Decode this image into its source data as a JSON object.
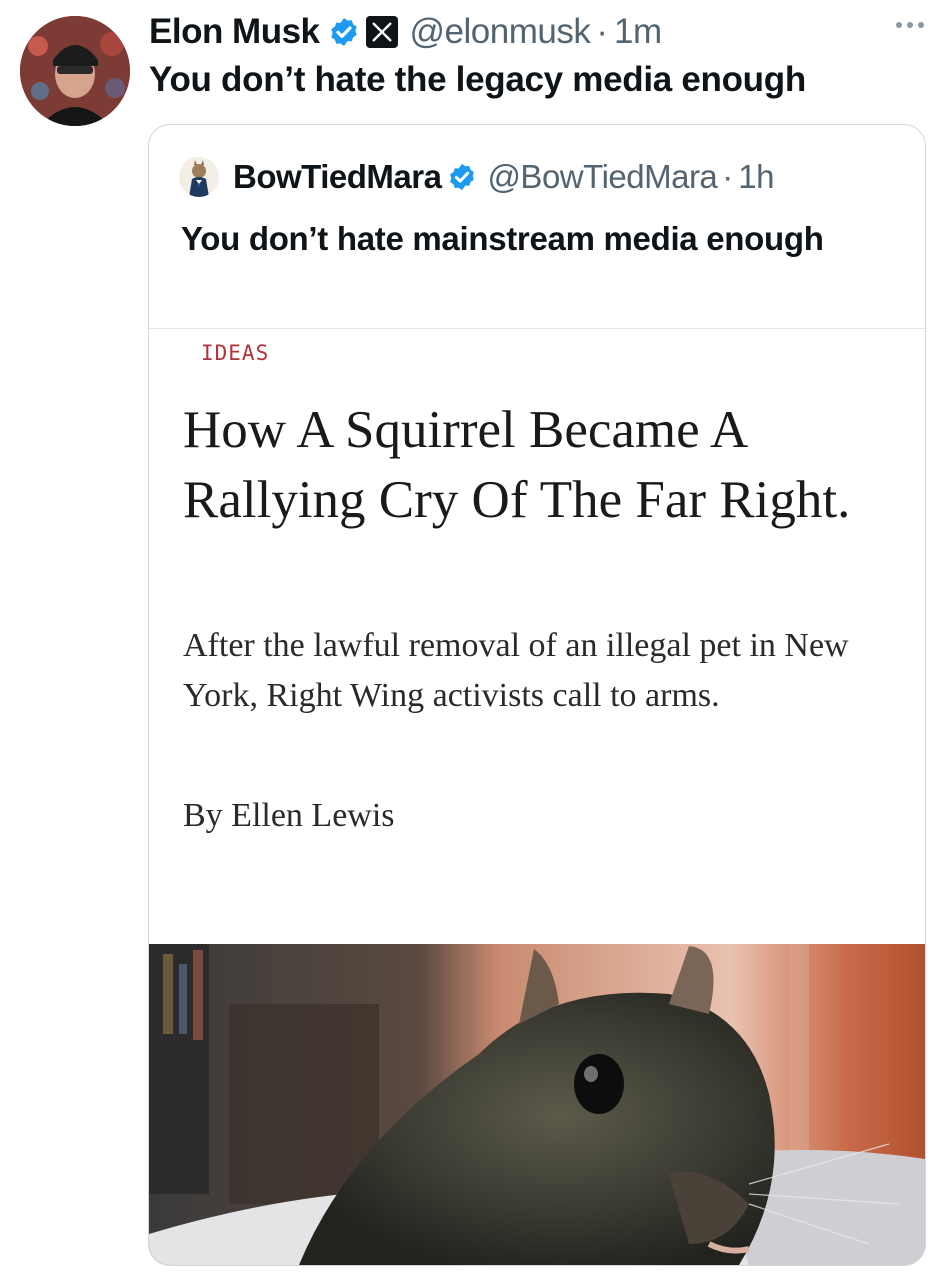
{
  "tweet": {
    "author_name": "Elon Musk",
    "author_handle": "@elonmusk",
    "separator": "·",
    "time": "1m",
    "text": "You don’t hate the legacy media enough",
    "more_icon": "more-horizontal-icon"
  },
  "quoted_tweet": {
    "author_name": "BowTiedMara",
    "author_handle": "@BowTiedMara",
    "separator": "·",
    "time": "1h",
    "text": "You don’t hate mainstream media enough"
  },
  "article": {
    "section": "IDEAS",
    "headline": "How A Squirrel Became A Rallying Cry Of The Far Right.",
    "dek": "After the lawful removal of an illegal pet in New York, Right Wing activists call to arms.",
    "byline": "By Ellen Lewis",
    "image": "squirrel-photo"
  },
  "colors": {
    "verified_blue": "#1d9bf0",
    "muted_text": "#536471",
    "section_red": "#b3323a"
  }
}
